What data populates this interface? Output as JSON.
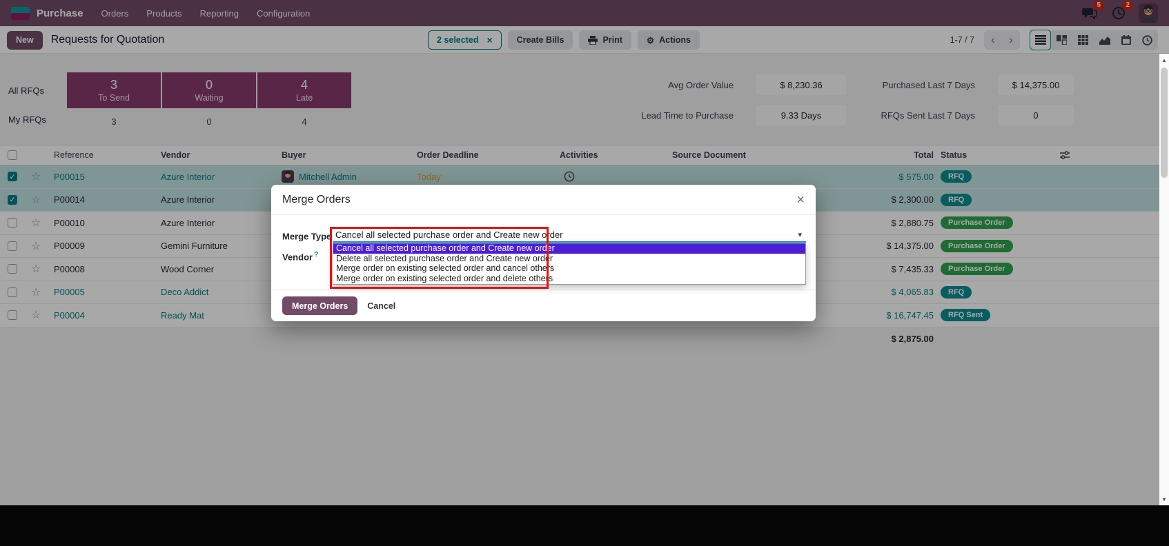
{
  "navbar": {
    "app_name": "Purchase",
    "menus": [
      "Orders",
      "Products",
      "Reporting",
      "Configuration"
    ],
    "badges": {
      "messages": "5",
      "activities": "2"
    }
  },
  "control_panel": {
    "new_label": "New",
    "breadcrumb": "Requests for Quotation",
    "selection_chip": "2 selected",
    "buttons": {
      "create_bills": "Create Bills",
      "print": "Print",
      "actions": "Actions"
    },
    "pager": "1-7 / 7"
  },
  "dashboard": {
    "left": {
      "rows": [
        {
          "label": "All RFQs",
          "cards": [
            {
              "value": "3",
              "label": "To Send"
            },
            {
              "value": "0",
              "label": "Waiting"
            },
            {
              "value": "4",
              "label": "Late"
            }
          ]
        },
        {
          "label": "My RFQs",
          "values": [
            "3",
            "0",
            "4"
          ]
        }
      ]
    },
    "stats": [
      {
        "label": "Avg Order Value",
        "value": "$ 8,230.36"
      },
      {
        "label": "Purchased Last 7 Days",
        "value": "$ 14,375.00"
      },
      {
        "label": "Lead Time to Purchase",
        "value": "9.33 Days"
      },
      {
        "label": "RFQs Sent Last 7 Days",
        "value": "0"
      }
    ]
  },
  "table": {
    "columns": [
      "Reference",
      "Vendor",
      "Buyer",
      "Order Deadline",
      "Activities",
      "Source Document",
      "Total",
      "Status"
    ],
    "rows": [
      {
        "reference": "P00015",
        "vendor": "Azure Interior",
        "buyer": "Mitchell Admin",
        "deadline": "Today",
        "total": "$ 575.00",
        "status": "RFQ"
      },
      {
        "reference": "P00014",
        "vendor": "Azure Interior",
        "total": "$ 2,300.00",
        "status": "RFQ"
      },
      {
        "reference": "P00010",
        "vendor": "Azure Interior",
        "total": "$ 2,880.75",
        "status": "Purchase Order"
      },
      {
        "reference": "P00009",
        "vendor": "Gemini Furniture",
        "total": "$ 14,375.00",
        "status": "Purchase Order"
      },
      {
        "reference": "P00008",
        "vendor": "Wood Corner",
        "total": "$ 7,435.33",
        "status": "Purchase Order"
      },
      {
        "reference": "P00005",
        "vendor": "Deco Addict",
        "total": "$ 4,065.83",
        "status": "RFQ"
      },
      {
        "reference": "P00004",
        "vendor": "Ready Mat",
        "total": "$ 16,747.45",
        "status": "RFQ Sent"
      }
    ],
    "footer_total": "$ 2,875.00"
  },
  "dialog": {
    "title": "Merge Orders",
    "merge_type": {
      "label": "Merge Type",
      "help": "?",
      "value": "Cancel all selected purchase order and Create new order",
      "options": [
        "Cancel all selected purchase order and Create new order",
        "Delete all selected purchase order and Create new order",
        "Merge order on existing selected order and cancel others",
        "Merge order on existing selected order and delete others"
      ],
      "highlighted_option": "Cancel all selected purchase order and Create new order"
    },
    "vendor": {
      "label": "Vendor",
      "help": "?"
    },
    "footer": {
      "confirm_label": "Merge Orders",
      "cancel_label": "Cancel"
    }
  },
  "icons": {
    "close": "×",
    "caret_down": "▾",
    "star": "☆",
    "check": "✓",
    "chevron_left": "‹",
    "chevron_right": "›",
    "gear": "⚙"
  },
  "colors": {
    "primary": "#714B67",
    "accent": "#017E84",
    "selected_row": "#C3E2E2",
    "kpi_card": "#873B6D",
    "badge_teal": "#0B8D92",
    "badge_green": "#2EA44E",
    "dropdown_highlight": "#4C1FD6",
    "annotation_red": "#E8130C",
    "deadline_warning": "#E0A029"
  }
}
